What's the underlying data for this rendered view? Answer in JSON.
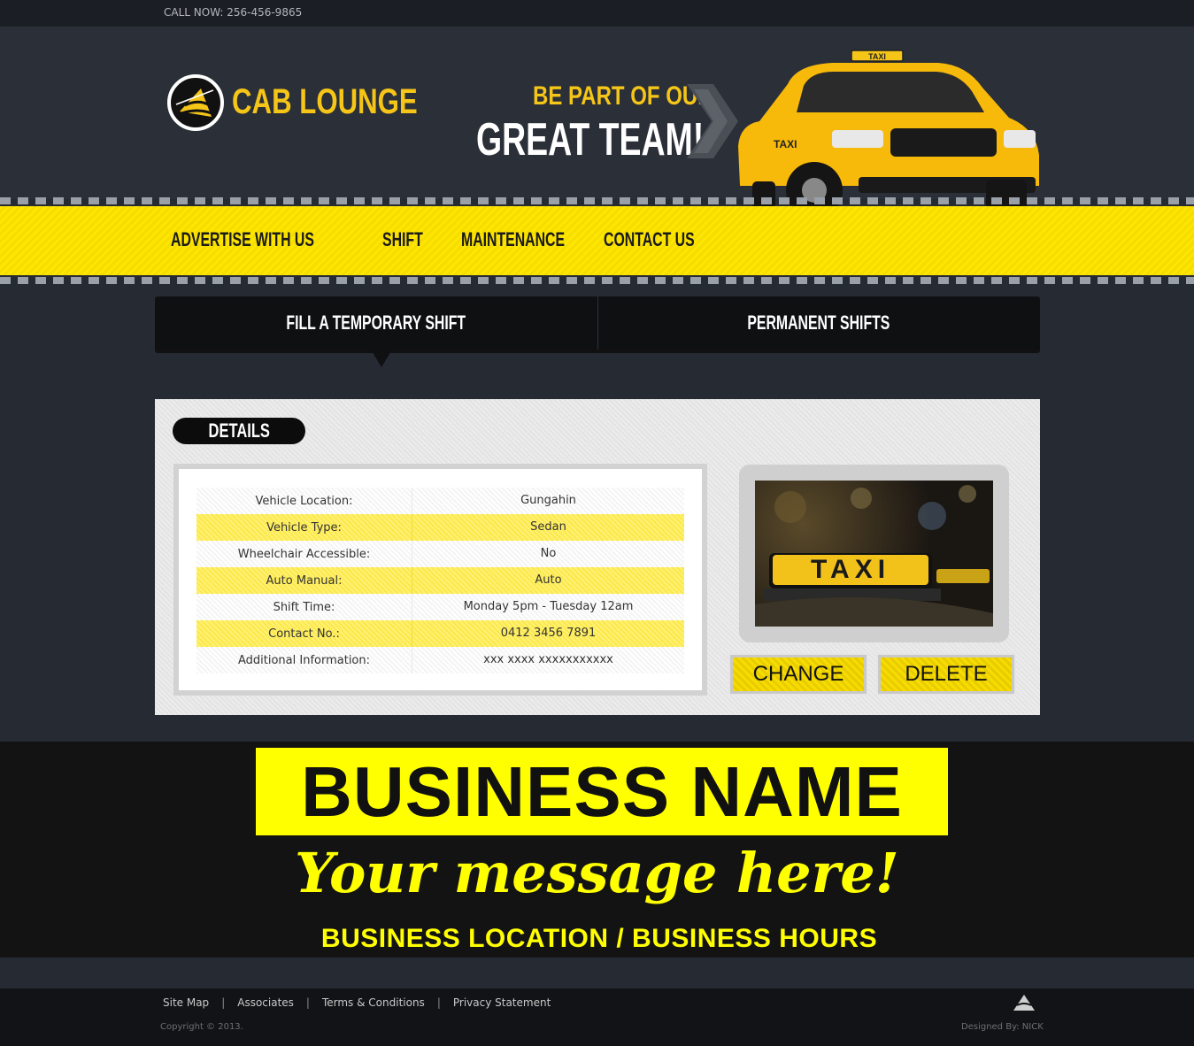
{
  "topbar": {
    "call_now": "CALL NOW: 256-456-9865"
  },
  "brand": {
    "name": "CAB LOUNGE"
  },
  "hero": {
    "line1": "BE PART OF OUR",
    "line2": "GREAT TEAM!"
  },
  "nav": {
    "items": [
      "ADVERTISE WITH US",
      "SHIFT",
      "MAINTENANCE",
      "CONTACT US"
    ]
  },
  "tabs": {
    "items": [
      "FILL A TEMPORARY SHIFT",
      "PERMANENT SHIFTS"
    ],
    "active": 0
  },
  "details": {
    "title": "DETAILS",
    "rows": [
      {
        "label": "Vehicle Location:",
        "value": "Gungahin"
      },
      {
        "label": "Vehicle Type:",
        "value": "Sedan"
      },
      {
        "label": "Wheelchair Accessible:",
        "value": "No"
      },
      {
        "label": "Auto Manual:",
        "value": "Auto"
      },
      {
        "label": "Shift Time:",
        "value": "Monday 5pm - Tuesday 12am"
      },
      {
        "label": "Contact No.:",
        "value": "0412 3456 7891"
      },
      {
        "label": "Additional Information:",
        "value": "xxx xxxx xxxxxxxxxxx"
      }
    ],
    "photo_sign": "TAXI",
    "change_label": "CHANGE",
    "delete_label": "DELETE"
  },
  "ad": {
    "business_name": "BUSINESS NAME",
    "message": "Your message here!",
    "location_hours": "BUSINESS LOCATION / BUSINESS HOURS"
  },
  "footer": {
    "links": [
      "Site Map",
      "Associates",
      "Terms & Conditions",
      "Privacy Statement"
    ],
    "copyright": "Copyright © 2013.",
    "designed_by": "Designed By: NICK"
  },
  "colors": {
    "accent_yellow": "#ffe600",
    "dark_bg": "#262b33"
  },
  "icons": [
    "logo-icon",
    "chevron-arrows-icon",
    "taxi-car-icon",
    "taxi-photo",
    "footer-logo-icon"
  ]
}
